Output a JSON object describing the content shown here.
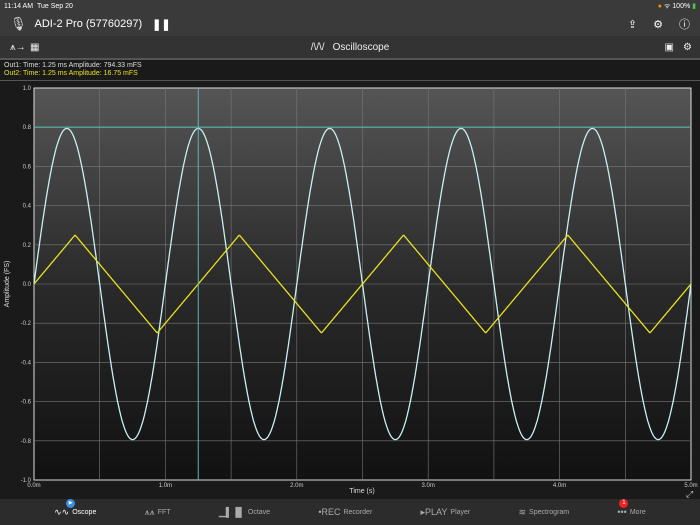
{
  "status": {
    "time": "11:14 AM",
    "date": "Tue Sep 20",
    "battery": "100%"
  },
  "header": {
    "device": "ADI-2 Pro (57760297)"
  },
  "toolbar": {
    "title": "Oscilloscope"
  },
  "readout": {
    "out1": "Out1:  Time: 1.25 ms   Amplitude: 794.33 mFS",
    "out2": "Out2:  Time: 1.25 ms   Amplitude: 16.75 mFS"
  },
  "colors": {
    "out1": "#c8f0f0",
    "out2": "#e8e020",
    "cursor": "#5ab8b0"
  },
  "chart_data": {
    "type": "line",
    "xlabel": "Time (s)",
    "ylabel": "Amplitude (FS)",
    "xlim": [
      0,
      5
    ],
    "ylim": [
      -1,
      1
    ],
    "xticks": [
      "0.0m",
      "1.0m",
      "2.0m",
      "3.0m",
      "4.0m",
      "5.0m"
    ],
    "yticks": [
      "1.0",
      "0.8",
      "0.6",
      "0.4",
      "0.2",
      "0.0",
      "-0.2",
      "-0.4",
      "-0.6",
      "-0.8",
      "-1.0"
    ],
    "series": [
      {
        "name": "Out1",
        "shape": "sine",
        "amplitude": 0.794,
        "period_ms": 1.0
      },
      {
        "name": "Out2",
        "shape": "triangle",
        "amplitude": 0.25,
        "period_ms": 1.25
      }
    ],
    "cursor": {
      "time_ms": 1.25,
      "level": 0.8
    }
  },
  "tabs": [
    {
      "label": "Oscope",
      "icon": "∿∿"
    },
    {
      "label": "FFT",
      "icon": "⩚⩚"
    },
    {
      "label": "Octave",
      "icon": "▁▌▐▌"
    },
    {
      "label": "Recorder",
      "icon": "•REC"
    },
    {
      "label": "Player",
      "icon": "▸PLAY"
    },
    {
      "label": "Spectrogram",
      "icon": "≋"
    },
    {
      "label": "More",
      "icon": "•••"
    }
  ],
  "more_badge": "1"
}
